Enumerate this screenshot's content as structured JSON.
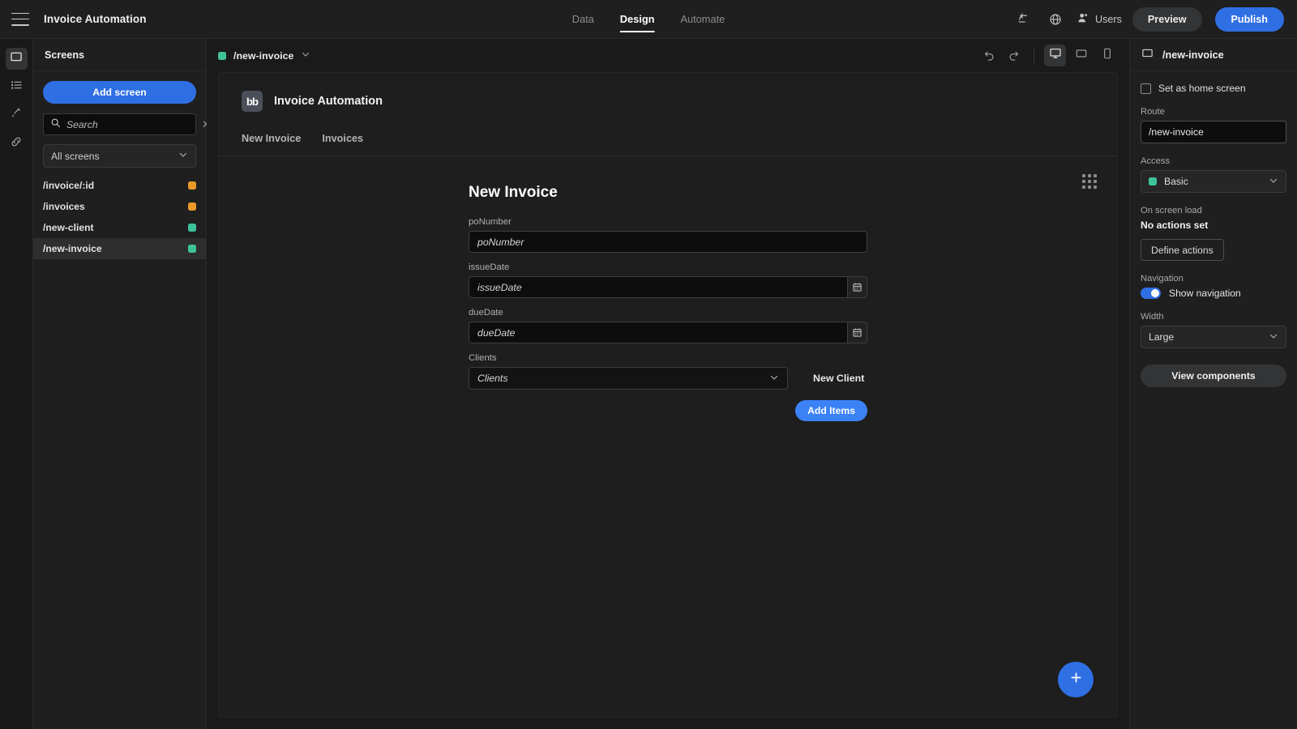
{
  "topbar": {
    "menu_icon": "hamburger-icon",
    "app_title": "Invoice Automation",
    "tabs": [
      {
        "label": "Data",
        "active": false
      },
      {
        "label": "Design",
        "active": true
      },
      {
        "label": "Automate",
        "active": false
      }
    ],
    "undo_icon": "undo-icon",
    "globe_icon": "globe-icon",
    "users_icon": "users-icon",
    "users_label": "Users",
    "preview_label": "Preview",
    "publish_label": "Publish",
    "publish_color": "#2f6fe4"
  },
  "rail": {
    "items": [
      {
        "name": "screens",
        "icon": "window-icon",
        "active": true
      },
      {
        "name": "components",
        "icon": "list-icon",
        "active": false
      },
      {
        "name": "theme",
        "icon": "brush-icon",
        "active": false
      },
      {
        "name": "links",
        "icon": "link-icon",
        "active": false
      }
    ]
  },
  "screens_panel": {
    "heading": "Screens",
    "add_button": "Add screen",
    "search_placeholder": "Search",
    "search_value": "",
    "clear_icon": "close-icon",
    "search_icon": "search-icon",
    "filter_value": "All screens",
    "items": [
      {
        "route": "/invoice/:id",
        "color": "#e8992a",
        "selected": false
      },
      {
        "route": "/invoices",
        "color": "#e8992a",
        "selected": false
      },
      {
        "route": "/new-client",
        "color": "#3ec29a",
        "selected": false
      },
      {
        "route": "/new-invoice",
        "color": "#3ec29a",
        "selected": true
      }
    ]
  },
  "canvas_bar": {
    "route_label": "/new-invoice",
    "route_color": "#3ec29a",
    "chevron_icon": "chevron-down-icon",
    "undo_icon": "undo-icon",
    "redo_icon": "redo-icon",
    "devices": [
      {
        "name": "desktop",
        "icon": "desktop-icon",
        "active": true
      },
      {
        "name": "tablet",
        "icon": "tablet-icon",
        "active": false
      },
      {
        "name": "mobile",
        "icon": "mobile-icon",
        "active": false
      }
    ]
  },
  "preview": {
    "logo_text": "bb",
    "app_name": "Invoice Automation",
    "nav_links": [
      "New Invoice",
      "Invoices"
    ],
    "grid_icon": "grid-dots-icon",
    "form": {
      "title": "New Invoice",
      "fields": [
        {
          "label": "poNumber",
          "placeholder": "poNumber",
          "type": "text"
        },
        {
          "label": "issueDate",
          "placeholder": "issueDate",
          "type": "date"
        },
        {
          "label": "dueDate",
          "placeholder": "dueDate",
          "type": "date"
        }
      ],
      "clients_label": "Clients",
      "clients_placeholder": "Clients",
      "new_client_label": "New Client",
      "add_items_label": "Add Items",
      "calendar_icon": "calendar-icon"
    },
    "fab_icon": "plus-icon"
  },
  "props": {
    "header_icon": "screen-icon",
    "header_title": "/new-invoice",
    "home_checkbox_label": "Set as home screen",
    "home_checkbox_checked": false,
    "route_label": "Route",
    "route_value": "/new-invoice",
    "access_label": "Access",
    "access_value": "Basic",
    "access_color": "#3ec29a",
    "onload_label": "On screen load",
    "onload_value": "No actions set",
    "define_actions_label": "Define actions",
    "navigation_label": "Navigation",
    "show_nav_label": "Show navigation",
    "show_nav_on": true,
    "width_label": "Width",
    "width_value": "Large",
    "view_components_label": "View components"
  }
}
